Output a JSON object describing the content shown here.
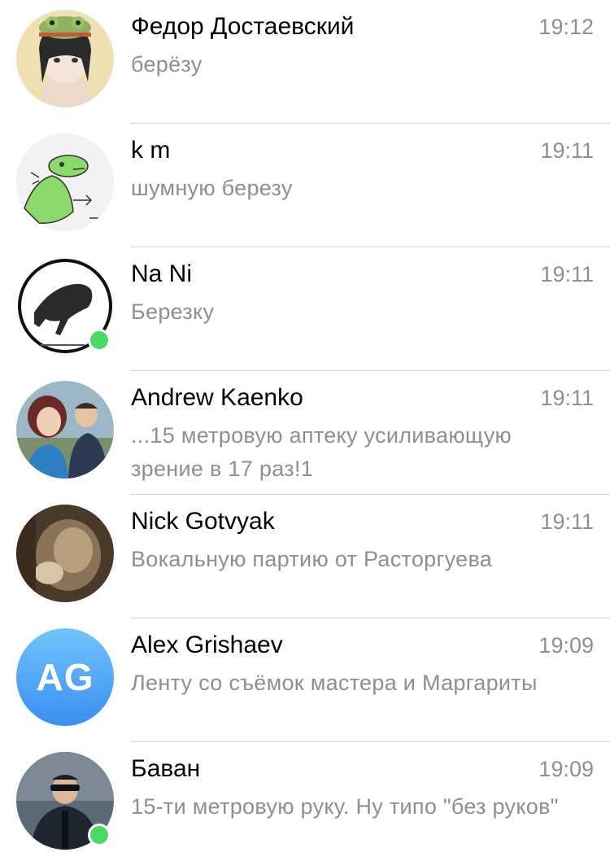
{
  "chats": [
    {
      "name": "Федор Достаевский",
      "time": "19:12",
      "message": "берёзу",
      "online": false,
      "avatar": "frog-hat-anime-girl"
    },
    {
      "name": "k m",
      "time": "19:11",
      "message": "шумную березу",
      "online": false,
      "avatar": "green-creature-drawing"
    },
    {
      "name": "Na Ni",
      "time": "19:11",
      "message": "Березку",
      "online": true,
      "avatar": "cat-in-circle-logo"
    },
    {
      "name": "Andrew Kaenko",
      "time": "19:11",
      "message": "...15 метровую аптеку усиливающую зрение в 17 раз!1",
      "online": false,
      "avatar": "two-people-photo"
    },
    {
      "name": "Nick Gotvyak",
      "time": "19:11",
      "message": "Вокальную партию от Расторгуева",
      "online": false,
      "avatar": "blurry-photo"
    },
    {
      "name": "Alex Grishaev",
      "time": "19:09",
      "message": "Ленту со съёмок мастера и Маргариты",
      "online": false,
      "avatar": "initials",
      "initials": "AG"
    },
    {
      "name": "Баван",
      "time": "19:09",
      "message": "15-ти метровую руку. Ну типо \"без руков\"",
      "online": true,
      "avatar": "person-sunglasses-photo"
    }
  ],
  "colors": {
    "online": "#4cd964",
    "secondary_text": "#8e8e93",
    "avatar_gradient_top": "#72c4fb",
    "avatar_gradient_bottom": "#3a8ef0"
  }
}
